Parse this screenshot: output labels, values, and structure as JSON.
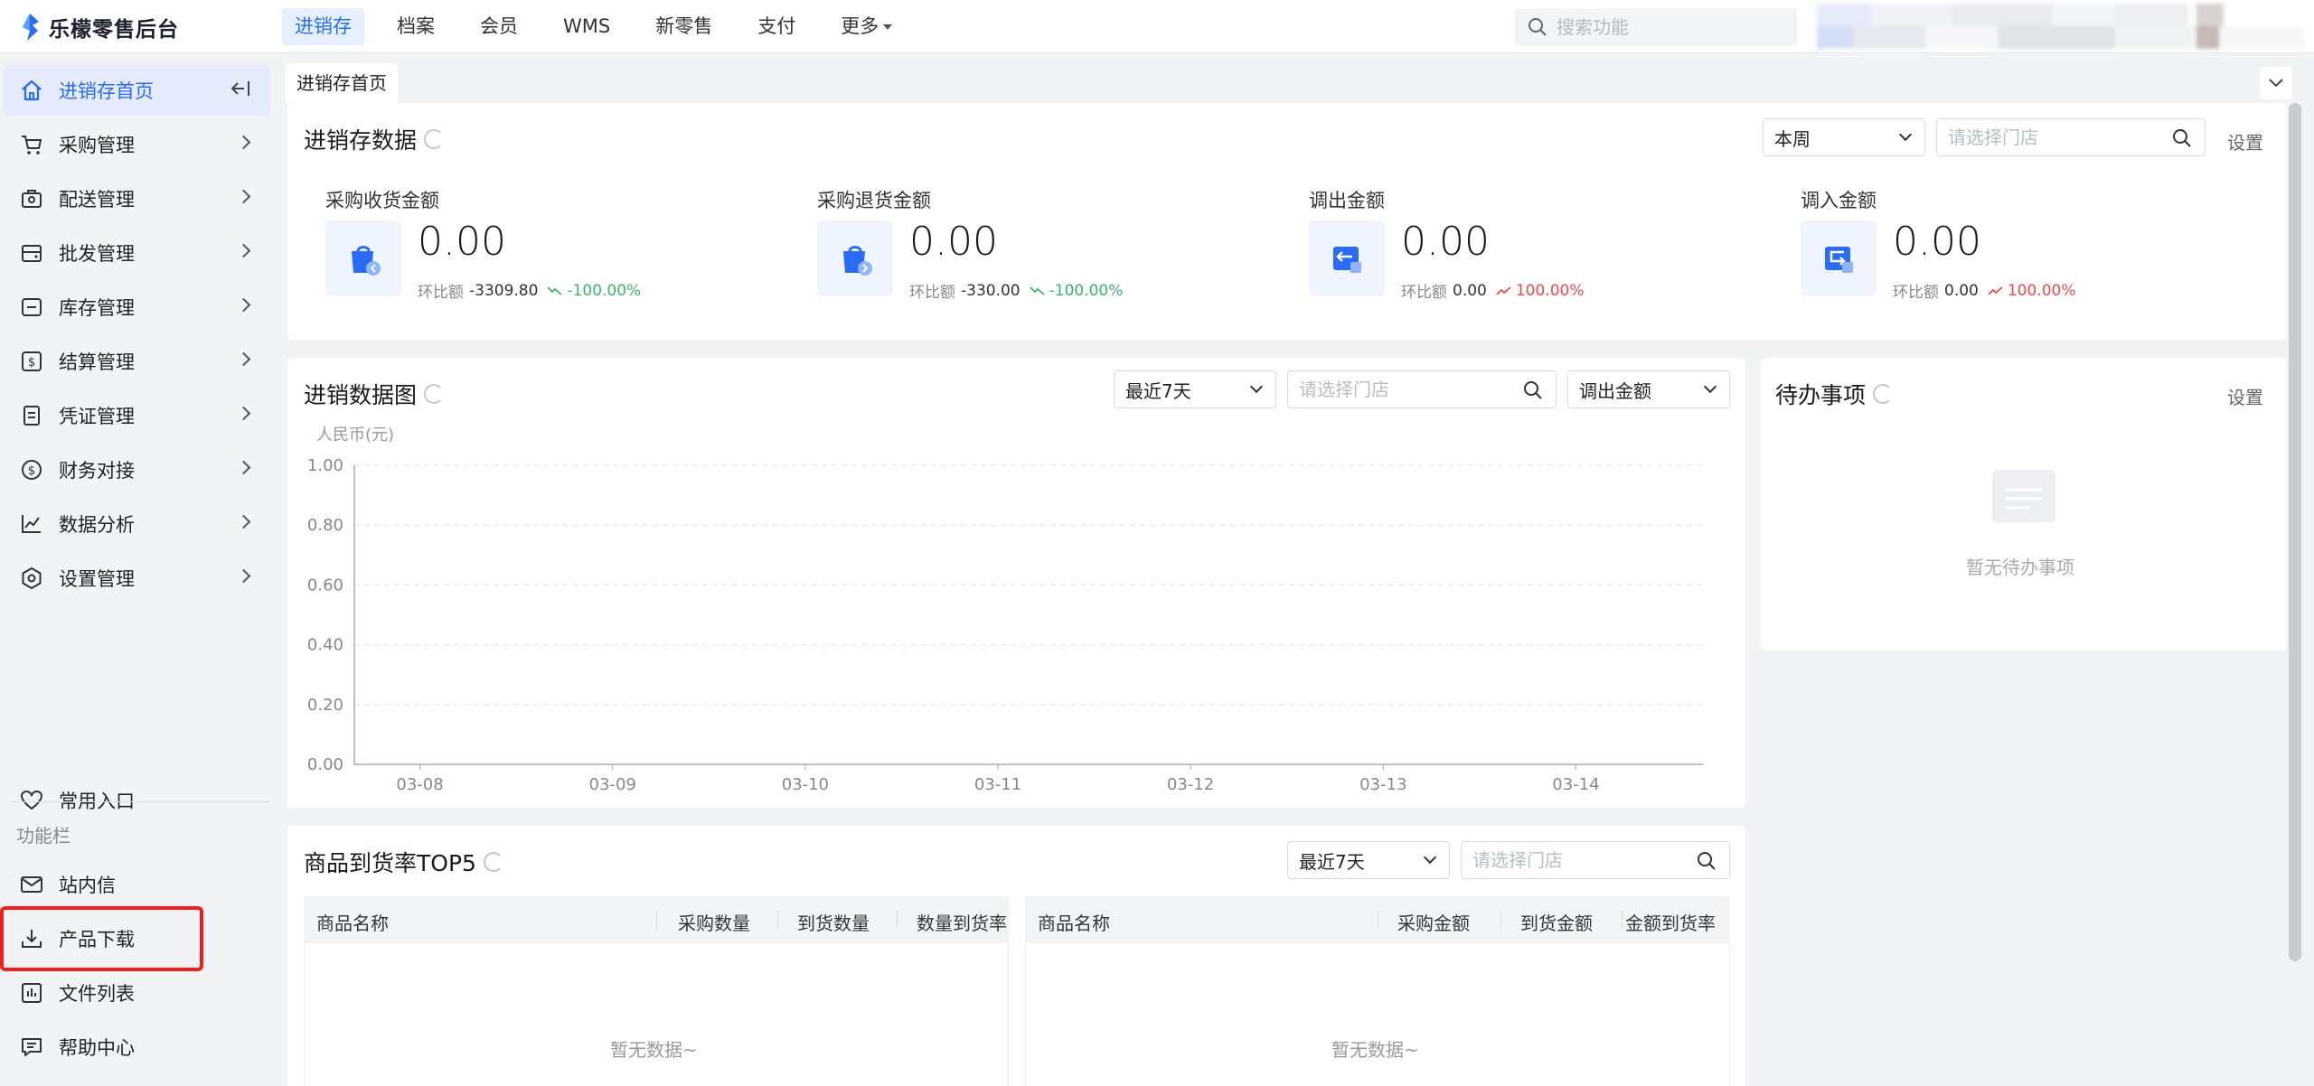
{
  "app": {
    "title": "乐檬零售后台"
  },
  "topnav": {
    "items": [
      "进销存",
      "档案",
      "会员",
      "WMS",
      "新零售",
      "支付",
      "更多"
    ],
    "search_placeholder": "搜索功能"
  },
  "sidebar": {
    "items": [
      {
        "label": "进销存首页",
        "icon": "home-icon"
      },
      {
        "label": "采购管理",
        "icon": "cart-icon"
      },
      {
        "label": "配送管理",
        "icon": "delivery-icon"
      },
      {
        "label": "批发管理",
        "icon": "wallet-icon"
      },
      {
        "label": "库存管理",
        "icon": "inventory-icon"
      },
      {
        "label": "结算管理",
        "icon": "settlement-icon"
      },
      {
        "label": "凭证管理",
        "icon": "voucher-icon"
      },
      {
        "label": "财务对接",
        "icon": "finance-icon"
      },
      {
        "label": "数据分析",
        "icon": "chart-icon"
      },
      {
        "label": "设置管理",
        "icon": "settings-icon"
      }
    ],
    "favorites_label": "常用入口",
    "group_label": "功能栏",
    "tools": [
      {
        "label": "站内信",
        "icon": "mail-icon"
      },
      {
        "label": "产品下载",
        "icon": "download-icon"
      },
      {
        "label": "文件列表",
        "icon": "file-list-icon"
      },
      {
        "label": "帮助中心",
        "icon": "help-icon"
      }
    ]
  },
  "tabs": {
    "active": "进销存首页"
  },
  "overview": {
    "title": "进销存数据",
    "period": "本周",
    "store_placeholder": "请选择门店",
    "settings_label": "设置",
    "compare_label": "环比额",
    "metrics": [
      {
        "label": "采购收货金额",
        "value": "0.00",
        "compare": "-3309.80",
        "pct": "-100.00%",
        "trend": "down"
      },
      {
        "label": "采购退货金额",
        "value": "0.00",
        "compare": "-330.00",
        "pct": "-100.00%",
        "trend": "down"
      },
      {
        "label": "调出金额",
        "value": "0.00",
        "compare": "0.00",
        "pct": "100.00%",
        "trend": "up"
      },
      {
        "label": "调入金额",
        "value": "0.00",
        "compare": "0.00",
        "pct": "100.00%",
        "trend": "up"
      }
    ]
  },
  "chart_panel": {
    "title": "进销数据图",
    "period": "最近7天",
    "store_placeholder": "请选择门店",
    "metric": "调出金额"
  },
  "chart_data": {
    "type": "line",
    "ylabel": "人民币(元)",
    "xlabel": "",
    "categories": [
      "03-08",
      "03-09",
      "03-10",
      "03-11",
      "03-12",
      "03-13",
      "03-14"
    ],
    "yticks": [
      "0.00",
      "0.20",
      "0.40",
      "0.60",
      "0.80",
      "1.00"
    ],
    "ylim": [
      0,
      1
    ],
    "series": [],
    "grid": true
  },
  "todo": {
    "title": "待办事项",
    "settings_label": "设置",
    "empty_text": "暂无待办事项"
  },
  "top5": {
    "title": "商品到货率TOP5",
    "period": "最近7天",
    "store_placeholder": "请选择门店",
    "left_table": {
      "columns": [
        "商品名称",
        "采购数量",
        "到货数量",
        "数量到货率"
      ],
      "empty_text": "暂无数据~"
    },
    "right_table": {
      "columns": [
        "商品名称",
        "采购金额",
        "到货金额",
        "金额到货率"
      ],
      "empty_text": "暂无数据~"
    }
  },
  "colors": {
    "accent": "#2a6cf6",
    "highlight": "#f01e1e",
    "down": "#3cb371",
    "up": "#f04848"
  }
}
